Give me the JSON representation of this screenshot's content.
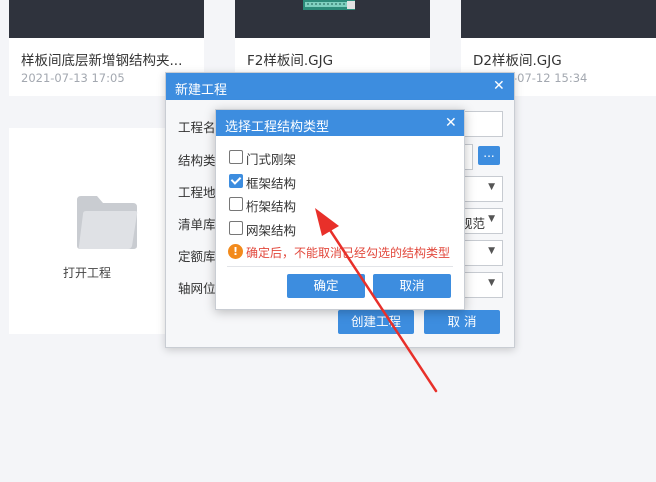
{
  "projects": [
    {
      "name": "样板间底层新增钢结构夹...",
      "date": "2021-07-13 17:05"
    },
    {
      "name": "F2样板间.GJG",
      "date": ""
    },
    {
      "name": "D2样板间.GJG",
      "date": "-07-12 15:34"
    }
  ],
  "open_project": {
    "label": "打开工程"
  },
  "new_project_dialog": {
    "title": "新建工程",
    "close_glyph": "✕",
    "rows": [
      {
        "label": "工程名",
        "fragment": ""
      },
      {
        "label": "结构类",
        "fragment": ""
      },
      {
        "label": "工程地",
        "fragment": ""
      },
      {
        "label": "清单库:",
        "fragment": "规范"
      },
      {
        "label": "定额库:",
        "fragment": ""
      },
      {
        "label": "轴网位",
        "fragment": ""
      }
    ],
    "browse_label": "...",
    "create_label": "创建工程",
    "cancel_label": "取 消"
  },
  "structure_type_dialog": {
    "title": "选择工程结构类型",
    "close_glyph": "✕",
    "options": [
      {
        "label": "门式刚架",
        "checked": false
      },
      {
        "label": "框架结构",
        "checked": true
      },
      {
        "label": "桁架结构",
        "checked": false
      },
      {
        "label": "网架结构",
        "checked": false
      }
    ],
    "warning_icon": "!",
    "warning": "确定后，不能取消已经勾选的结构类型",
    "confirm_label": "确定",
    "cancel_label": "取消"
  },
  "colors": {
    "accent": "#3d8ddf",
    "warning": "#e2483c",
    "arrow": "#e8302a"
  }
}
